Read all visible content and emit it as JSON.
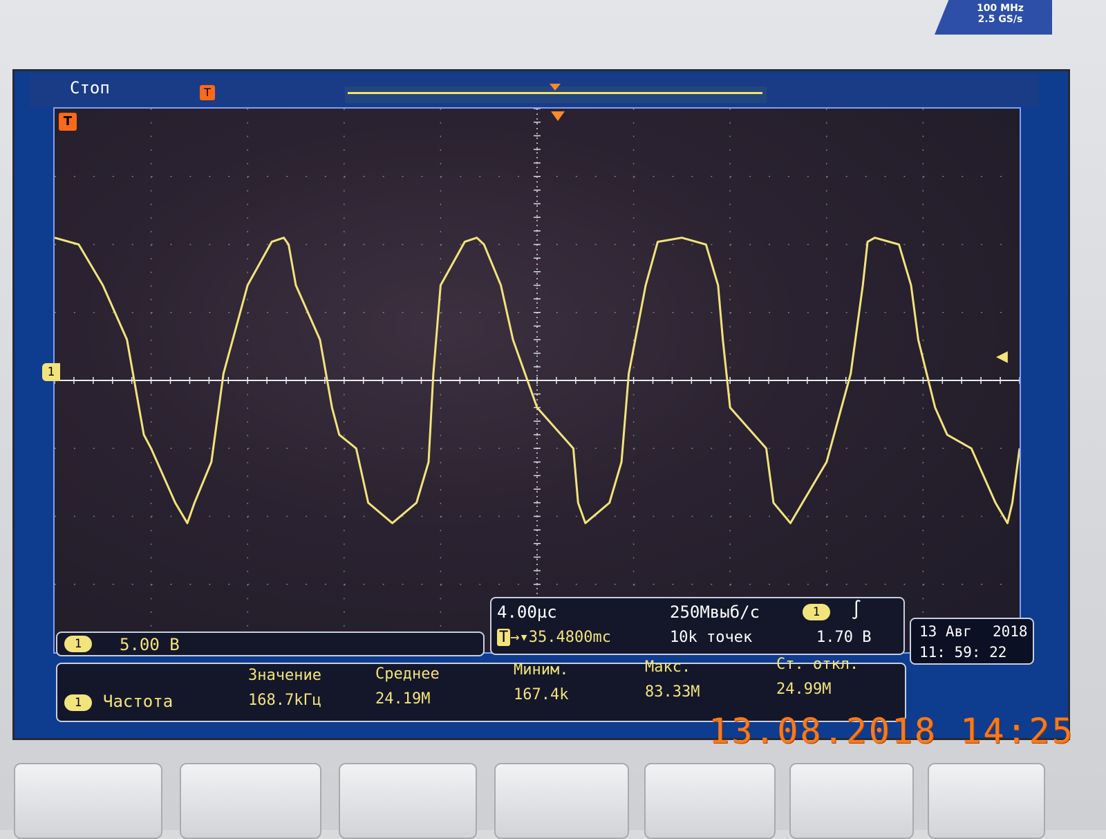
{
  "device": {
    "badge_line1": "100 MHz",
    "badge_line2": "2.5 GS/s"
  },
  "status": {
    "run_state": "Стоп",
    "trigger_icon": "T"
  },
  "channel": {
    "id": "1",
    "scale": "5.00 В",
    "color": "#f3e37c"
  },
  "timebase": {
    "horizontal_scale": "4.00µс",
    "trigger_position": "35.4800mc",
    "sample_rate": "250Мвыб/с",
    "record_length": "10k точек",
    "trigger_level": "1.70 В",
    "trigger_slope_icon": "rising-edge-icon"
  },
  "datetime": {
    "date": "13 Авг",
    "year": "2018",
    "time": "11: 59: 22"
  },
  "measurement": {
    "name": "Частота",
    "headers": [
      "Значение",
      "Среднее",
      "Миним.",
      "Макс.",
      "Ст. откл."
    ],
    "values": [
      "168.7kГц",
      "24.19M",
      "167.4k",
      "83.33M",
      "24.99M"
    ]
  },
  "camera_stamp": "13.08.2018 14:25",
  "chart_data": {
    "type": "line",
    "divisions": {
      "x": 10,
      "y": 8
    },
    "x_unit_per_div": "4.00µс",
    "y_unit_per_div": "5.00 В",
    "series": [
      {
        "x": [
          -20,
          -19,
          -18,
          -17,
          -16.5,
          -16.3,
          -16,
          -15,
          -14.5,
          -14.2,
          -13.5,
          -13,
          -12,
          -11,
          -10.5,
          -10.3,
          -10,
          -9,
          -8.5,
          -8.2,
          -7.5,
          -7,
          -6,
          -5,
          -4.5,
          -4.3,
          -4,
          -3,
          -2.5,
          -2.2,
          -1.5,
          -1,
          0,
          1,
          1.5,
          1.7,
          2,
          3,
          3.5,
          3.8,
          4.5,
          5,
          6,
          7,
          7.5,
          7.7,
          8,
          9,
          9.5,
          9.8,
          10.5,
          11,
          12,
          13,
          13.5,
          13.7,
          14,
          15,
          15.5,
          15.8,
          16.5,
          17,
          18,
          19,
          19.5,
          19.7,
          20
        ],
        "y": [
          10.5,
          10,
          7,
          3,
          -2,
          -4,
          -5,
          -9,
          -10.5,
          -9,
          -6,
          0.5,
          7,
          10.2,
          10.5,
          10,
          7,
          3,
          -2,
          -4,
          -5,
          -9,
          -10.5,
          -9,
          -6,
          0.5,
          7,
          10.2,
          10.5,
          10,
          7,
          3,
          -2,
          -4,
          -5,
          -9,
          -10.5,
          -9,
          -6,
          0.5,
          7,
          10.2,
          10.5,
          10,
          7,
          3,
          -2,
          -4,
          -5,
          -9,
          -10.5,
          -9,
          -6,
          0.5,
          7,
          10.2,
          10.5,
          10,
          7,
          3,
          -2,
          -4,
          -5,
          -9,
          -10.5,
          -9,
          -5
        ]
      }
    ]
  }
}
